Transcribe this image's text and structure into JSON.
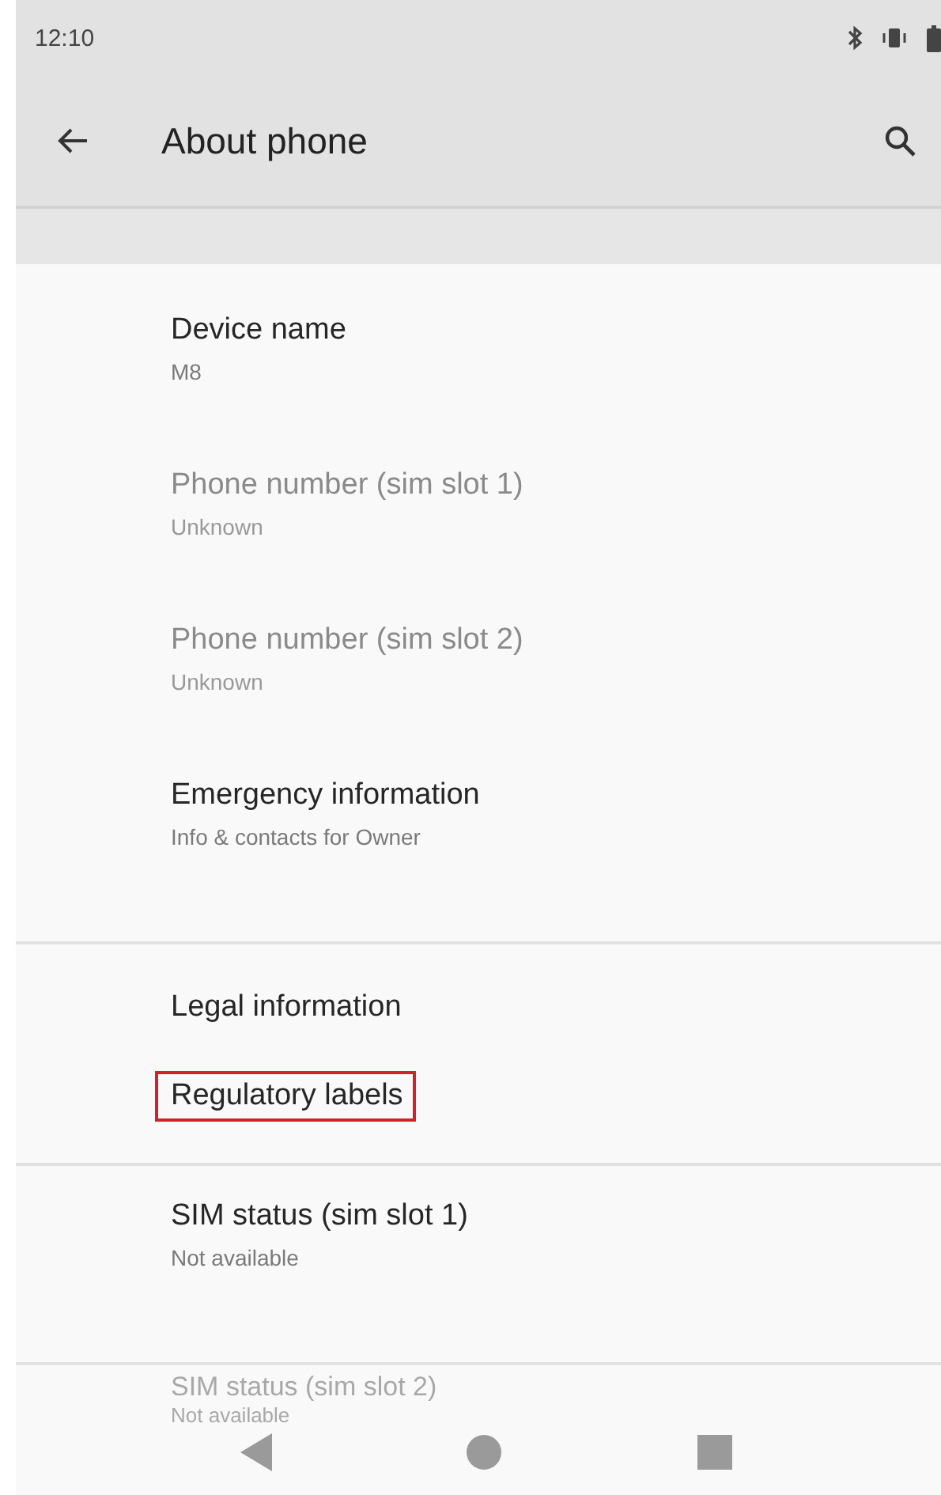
{
  "status_bar": {
    "time": "12:10"
  },
  "toolbar": {
    "title": "About phone"
  },
  "sections": [
    {
      "items": [
        {
          "title": "Device name",
          "subtitle": "M8",
          "disabled": false,
          "highlighted": false
        },
        {
          "title": "Phone number (sim slot 1)",
          "subtitle": "Unknown",
          "disabled": true,
          "highlighted": false
        },
        {
          "title": "Phone number (sim slot 2)",
          "subtitle": "Unknown",
          "disabled": true,
          "highlighted": false
        },
        {
          "title": "Emergency information",
          "subtitle": "Info & contacts for Owner",
          "disabled": false,
          "highlighted": false
        }
      ]
    },
    {
      "items": [
        {
          "title": "Legal information",
          "disabled": false,
          "highlighted": false
        },
        {
          "title": "Regulatory labels",
          "disabled": false,
          "highlighted": true
        }
      ]
    },
    {
      "items": [
        {
          "title": "SIM status (sim slot 1)",
          "subtitle": "Not available",
          "disabled": false,
          "highlighted": false
        }
      ]
    }
  ],
  "behind_nav": {
    "title": "SIM status (sim slot 2)",
    "subtitle": "Not available"
  }
}
